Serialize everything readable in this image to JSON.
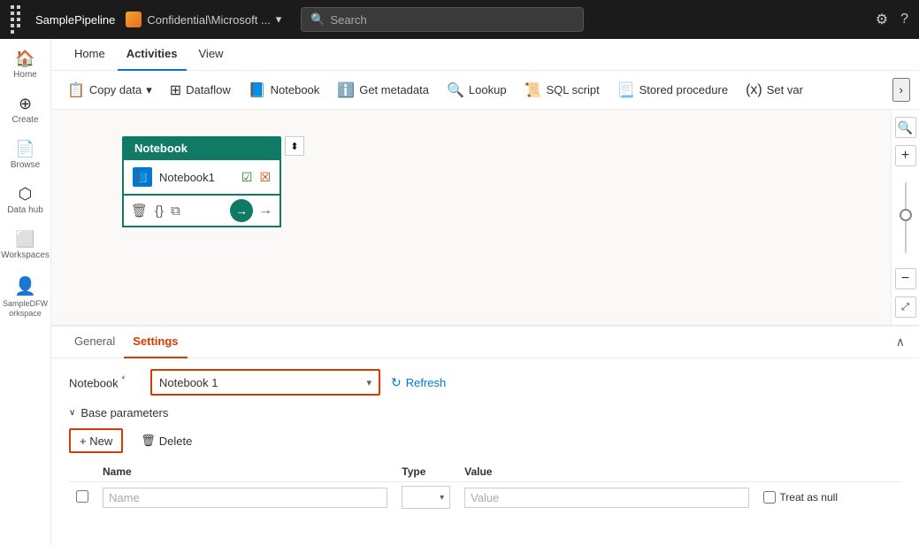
{
  "topbar": {
    "waffle_label": "Apps",
    "pipeline_name": "SamplePipeline",
    "org_name": "Confidential\\Microsoft ...",
    "search_placeholder": "Search",
    "settings_icon": "⚙",
    "help_icon": "?"
  },
  "sidebar": {
    "items": [
      {
        "id": "home",
        "icon": "🏠",
        "label": "Home"
      },
      {
        "id": "create",
        "icon": "+",
        "label": "Create"
      },
      {
        "id": "browse",
        "icon": "📄",
        "label": "Browse"
      },
      {
        "id": "datahub",
        "icon": "⊞",
        "label": "Data hub"
      },
      {
        "id": "workspaces",
        "icon": "⬜",
        "label": "Workspaces"
      },
      {
        "id": "sampledfw",
        "icon": "👤",
        "label": "SampleDFW orkspace"
      }
    ]
  },
  "menubar": {
    "tabs": [
      {
        "id": "home",
        "label": "Home"
      },
      {
        "id": "activities",
        "label": "Activities",
        "active": true
      },
      {
        "id": "view",
        "label": "View"
      }
    ]
  },
  "toolbar": {
    "buttons": [
      {
        "id": "copy-data",
        "icon": "📋",
        "label": "Copy data",
        "has_dropdown": true
      },
      {
        "id": "dataflow",
        "icon": "⊞",
        "label": "Dataflow"
      },
      {
        "id": "notebook",
        "icon": "📘",
        "label": "Notebook"
      },
      {
        "id": "get-metadata",
        "icon": "ℹ",
        "label": "Get metadata"
      },
      {
        "id": "lookup",
        "icon": "🔍",
        "label": "Lookup"
      },
      {
        "id": "sql-script",
        "icon": "📜",
        "label": "SQL script"
      },
      {
        "id": "stored-procedure",
        "icon": "📃",
        "label": "Stored procedure"
      },
      {
        "id": "set-var",
        "icon": "(x)",
        "label": "Set var"
      }
    ],
    "more_label": "›"
  },
  "canvas": {
    "node": {
      "title": "Notebook",
      "icon": "📘",
      "activity_name": "Notebook1",
      "status_ok": "✓",
      "status_err": "✗"
    }
  },
  "properties": {
    "tabs": [
      {
        "id": "general",
        "label": "General"
      },
      {
        "id": "settings",
        "label": "Settings",
        "active": true
      }
    ],
    "settings": {
      "notebook_label": "Notebook",
      "notebook_required": "*",
      "notebook_value": "Notebook 1",
      "refresh_label": "Refresh",
      "base_params_label": "Base parameters",
      "new_btn_label": "+ New",
      "delete_btn_label": "Delete",
      "table_headers": {
        "name": "Name",
        "type": "Type",
        "value": "Value"
      },
      "name_placeholder": "Name",
      "type_placeholder": "",
      "value_placeholder": "Value",
      "treat_as_null_label": "Treat as null"
    }
  }
}
